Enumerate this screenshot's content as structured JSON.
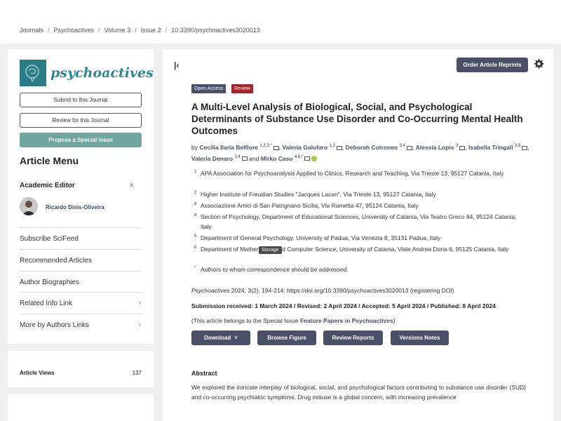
{
  "breadcrumb": [
    "Journals",
    "Psychoactives",
    "Volume 3",
    "Issue 2",
    "10.3390/psychoactives3020013"
  ],
  "sidebar": {
    "journal_name": "psychoactives",
    "submit_label": "Submit to this Journal",
    "review_label": "Review for this Journal",
    "propose_label": "Propose a Special Issue",
    "menu_title": "Article Menu",
    "editor_heading": "Academic Editor",
    "editor_name": "Ricardo Dinis-Oliveira",
    "links": [
      "Subscribe SciFeed",
      "Recommended Articles",
      "Author Biographies",
      "Related Info Link",
      "More by Authors Links"
    ],
    "views_label": "Article Views",
    "views_value": "137"
  },
  "article": {
    "reprint_label": "Order Article Reprints",
    "badge_open": "Open Access",
    "badge_review": "Review",
    "title": "A Multi-Level Analysis of Biological, Social, and Psychological Determinants of Substance Use Disorder and Co-Occurring Mental Health Outcomes",
    "by": "by",
    "authors": [
      {
        "name": "Cecilia Ilaria Belfiore",
        "sup": "1,2,3,*"
      },
      {
        "name": "Valeria Galofaro",
        "sup": "1,2"
      },
      {
        "name": "Deborah Cotroneo",
        "sup": "3,4"
      },
      {
        "name": "Alessia Lopis",
        "sup": "3"
      },
      {
        "name": "Isabella Tringali",
        "sup": "3,5"
      },
      {
        "name": "Valeria Denaro",
        "sup": "3,4"
      },
      {
        "name": "Mirko Casu",
        "sup": "4,6,*"
      }
    ],
    "and_word": "and",
    "affiliations": [
      {
        "num": "1",
        "text": "APA Association for Psychoanalysis Applied to Clinics, Research and Teaching, Via Trieste 13, 95127 Catania, Italy"
      },
      {
        "num": "2",
        "text": "Higher Institute of Freudian Studies \"Jacques Lacan\", Via Trieste 13, 95127 Catania, Italy"
      },
      {
        "num": "3",
        "text": "Associazione Amici di San Patrignano Sicilia, Via Rametta 47, 95124 Catania, Italy"
      },
      {
        "num": "4",
        "text": "Section of Psychology, Department of Educational Sciences, University of Catania, Via Teatro Greco 84, 95124 Catania, Italy"
      },
      {
        "num": "5",
        "text": "Department of General Psychology, University of Padua, Via Venezia 8, 35131 Padua, Italy"
      },
      {
        "num": "6",
        "text": "Department of Mathematics and Computer Science, University of Catania, Viale Andrea Doria 6, 95125 Catania, Italy"
      },
      {
        "num": "*",
        "text": "Authors to whom correspondence should be addressed."
      }
    ],
    "tooltip": "Storage",
    "citation_journal": "Psychoactives",
    "citation_rest": " 2024, 3(2), 194-214; https://doi.org/10.3390/psychoactives3020013 (registering DOI)",
    "dates": "Submission received: 1 March 2024 / Revised: 2 April 2024 / Accepted: 5 April 2024 / Published: 8 April 2024",
    "special_prefix": "(This article belongs to the Special Issue ",
    "special_link": "Feature Papers in Psychoactives",
    "special_suffix": ")",
    "buttons": {
      "download": "Download",
      "browse": "Browse Figure",
      "reviews": "Review Reports",
      "versions": "Versions Notes"
    },
    "abstract_heading": "Abstract",
    "abstract_text": "We explored the intricate interplay of biological, social, and psychological factors contributing to substance use disorder (SUD) and co-occurring psychiatric symptoms. Drug misuse is a global concern, with increasing prevalence"
  },
  "colors": {
    "accent": "#4b5069",
    "review_badge": "#a5232b",
    "teal": "#6fa6a2",
    "logo_teal": "#2a7d86"
  }
}
